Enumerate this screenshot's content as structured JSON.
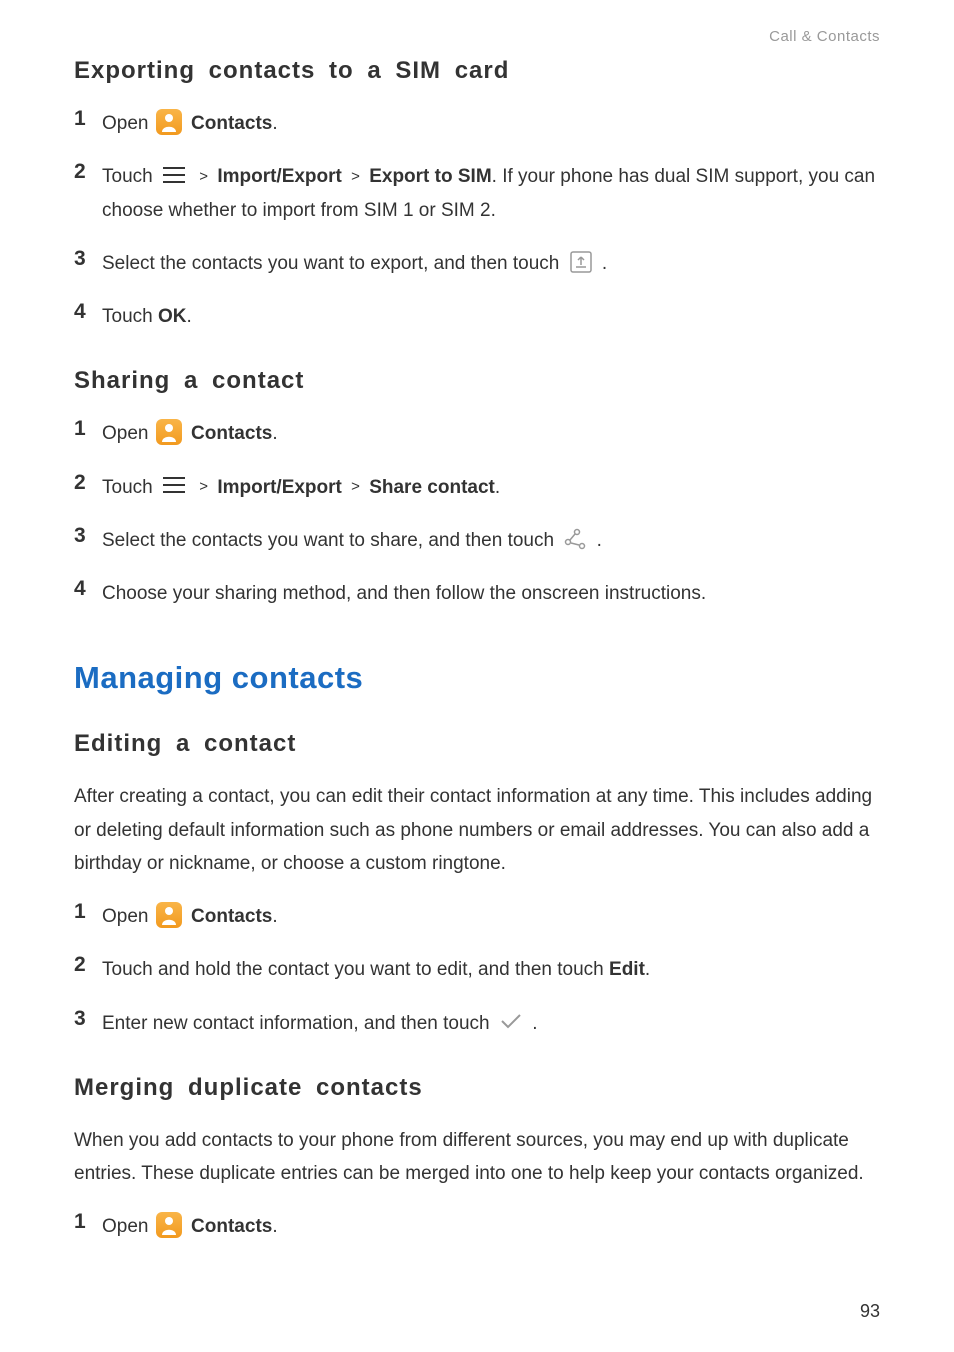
{
  "header": {
    "breadcrumb": "Call & Contacts"
  },
  "section1": {
    "heading": "Exporting contacts to a SIM card",
    "s1_num": "1",
    "s1_t1": "Open ",
    "s1_t2": "Contacts",
    "s1_t3": ".",
    "s2_num": "2",
    "s2_t1": "Touch ",
    "s2_gt1": ">",
    "s2_t2": "Import/Export",
    "s2_gt2": ">",
    "s2_t3": "Export to SIM",
    "s2_t4": ". If your phone has dual SIM support, you can choose whether to import from SIM 1 or SIM 2.",
    "s3_num": "3",
    "s3_t1": "Select the contacts you want to export, and then touch ",
    "s3_t2": ".",
    "s4_num": "4",
    "s4_t1": "Touch ",
    "s4_t2": "OK",
    "s4_t3": "."
  },
  "section2": {
    "heading": "Sharing a contact",
    "s1_num": "1",
    "s1_t1": "Open ",
    "s1_t2": "Contacts",
    "s1_t3": ".",
    "s2_num": "2",
    "s2_t1": "Touch ",
    "s2_gt1": ">",
    "s2_t2": "Import/Export",
    "s2_gt2": ">",
    "s2_t3": "Share contact",
    "s2_t4": ".",
    "s3_num": "3",
    "s3_t1": "Select the contacts you want to share, and then touch ",
    "s3_t2": ".",
    "s4_num": "4",
    "s4_t1": "Choose your sharing method, and then follow the onscreen instructions."
  },
  "chapter": {
    "heading": "Managing contacts"
  },
  "section3": {
    "heading": "Editing a contact",
    "intro": "After creating a contact, you can edit their contact information at any time. This includes adding or deleting default information such as phone numbers or email addresses. You can also add a birthday or nickname, or choose a custom ringtone.",
    "s1_num": "1",
    "s1_t1": "Open ",
    "s1_t2": "Contacts",
    "s1_t3": ".",
    "s2_num": "2",
    "s2_t1": "Touch and hold the contact you want to edit, and then touch ",
    "s2_t2": "Edit",
    "s2_t3": ".",
    "s3_num": "3",
    "s3_t1": "Enter new contact information, and then touch ",
    "s3_t2": "."
  },
  "section4": {
    "heading": "Merging duplicate contacts",
    "intro": "When you add contacts to your phone from different sources, you may end up with duplicate entries. These duplicate entries can be merged into one to help keep your contacts organized.",
    "s1_num": "1",
    "s1_t1": "Open ",
    "s1_t2": "Contacts",
    "s1_t3": "."
  },
  "footer": {
    "page": "93"
  }
}
